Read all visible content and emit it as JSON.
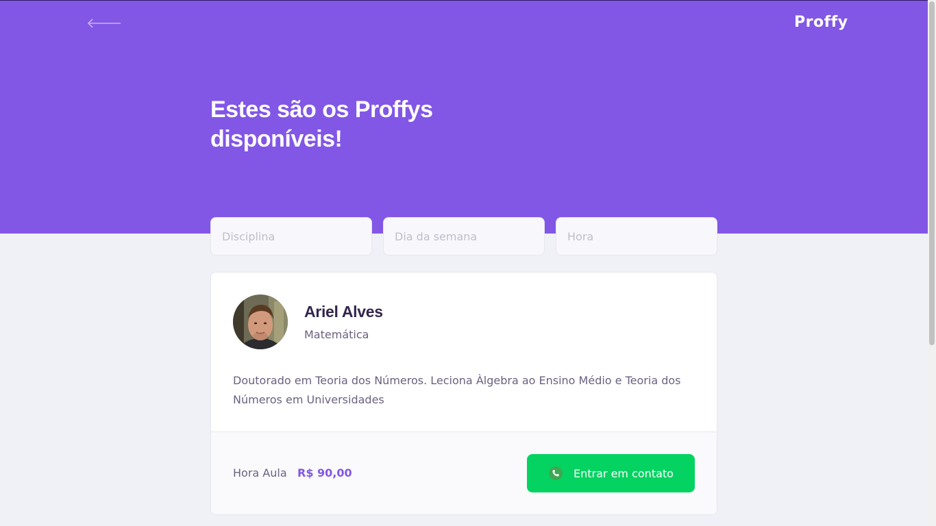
{
  "header": {
    "logo": "Proffy",
    "title_line1": "Estes são os Proffys",
    "title_line2": "disponíveis!",
    "back_icon": "arrow-left-icon"
  },
  "filters": {
    "subject_placeholder": "Disciplina",
    "weekday_placeholder": "Dia da semana",
    "time_placeholder": "Hora"
  },
  "teacher": {
    "name": "Ariel Alves",
    "subject": "Matemática",
    "bio": "Doutorado em Teoria dos Números. Leciona Àlgebra ao Ensino Médio e Teoria dos Números em Universidades",
    "price_label": "Hora Aula",
    "price": "R$ 90,00",
    "contact_label": "Entrar em contato",
    "contact_icon": "whatsapp-icon"
  },
  "colors": {
    "primary": "#8257E5",
    "background": "#F0F0F7",
    "success": "#04D361",
    "title_text": "#32264D",
    "body_text": "#6A6180"
  }
}
